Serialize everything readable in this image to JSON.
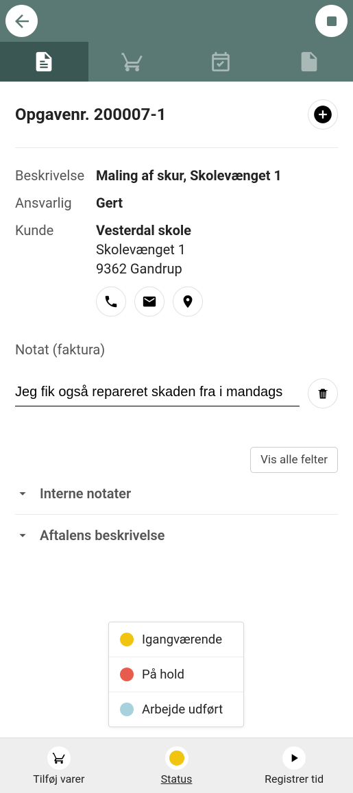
{
  "colors": {
    "status_yellow": "#f1c40f",
    "status_red": "#e85b4d",
    "status_blue": "#a6d2de"
  },
  "header": {
    "tabs": [
      "details",
      "cart",
      "schedule",
      "files"
    ],
    "active_tab": 0
  },
  "task": {
    "title": "Opgavenr. 200007-1",
    "fields": {
      "description_label": "Beskrivelse",
      "description_value": "Maling af skur, Skolevænget 1",
      "responsible_label": "Ansvarlig",
      "responsible_value": "Gert",
      "customer_label": "Kunde",
      "customer_name": "Vesterdal skole",
      "customer_addr1": "Skolevænget 1",
      "customer_addr2": "9362 Gandrup"
    }
  },
  "note": {
    "header": "Notat (faktura)",
    "value": "Jeg fik også repareret skaden fra i mandags"
  },
  "buttons": {
    "show_all_fields": "Vis alle felter"
  },
  "collapsibles": [
    {
      "label": "Interne notater"
    },
    {
      "label": "Aftalens beskrivelse"
    }
  ],
  "status_popup": {
    "items": [
      {
        "label": "Igangværende",
        "color": "#f1c40f"
      },
      {
        "label": "På hold",
        "color": "#e85b4d"
      },
      {
        "label": "Arbejde udført",
        "color": "#a6d2de"
      }
    ]
  },
  "footer": {
    "items": [
      {
        "label": "Tilføj varer",
        "icon": "cart",
        "color": "#000"
      },
      {
        "label": "Status",
        "icon": "dot",
        "color": "#f1c40f",
        "underline": true
      },
      {
        "label": "Registrer tid",
        "icon": "play",
        "color": "#000"
      }
    ]
  }
}
